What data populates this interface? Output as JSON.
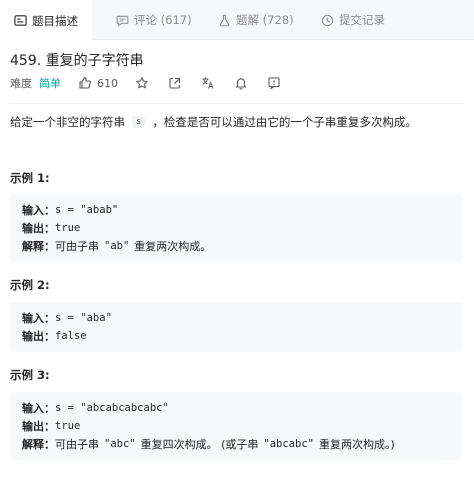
{
  "tabs": [
    {
      "label": "题目描述",
      "icon": "description-icon"
    },
    {
      "label": "评论 (617)",
      "icon": "comment-icon"
    },
    {
      "label": "题解 (728)",
      "icon": "flask-icon"
    },
    {
      "label": "提交记录",
      "icon": "history-icon"
    }
  ],
  "problem": {
    "title": "459. 重复的子字符串",
    "difficulty_label": "难度",
    "difficulty": "简单",
    "likes": "610",
    "description_before": "给定一个非空的字符串",
    "description_code": "s",
    "description_after": "，检查是否可以通过由它的一个子串重复多次构成。"
  },
  "examples": [
    {
      "title": "示例 1:",
      "input_label": "输入：",
      "input": "s = \"abab\"",
      "output_label": "输出：",
      "output": "true",
      "explain_label": "解释：",
      "explain_pre": "可由子串",
      "explain_code": "\"ab\"",
      "explain_post": "重复两次构成。"
    },
    {
      "title": "示例 2:",
      "input_label": "输入：",
      "input": "s = \"aba\"",
      "output_label": "输出：",
      "output": "false"
    },
    {
      "title": "示例 3:",
      "input_label": "输入：",
      "input": "s = \"abcabcabcabc\"",
      "output_label": "输出：",
      "output": "true",
      "explain_label": "解释：",
      "explain_pre": "可由子串",
      "explain_code": "\"abc\"",
      "explain_mid": "重复四次构成。 (或子串",
      "explain_code2": "\"abcabc\"",
      "explain_post": "重复两次构成。)"
    }
  ],
  "colors": {
    "difficulty_easy": "#00af9b",
    "tabbar_bg": "#f7f8fa",
    "example_bg": "#f7f8fa"
  }
}
